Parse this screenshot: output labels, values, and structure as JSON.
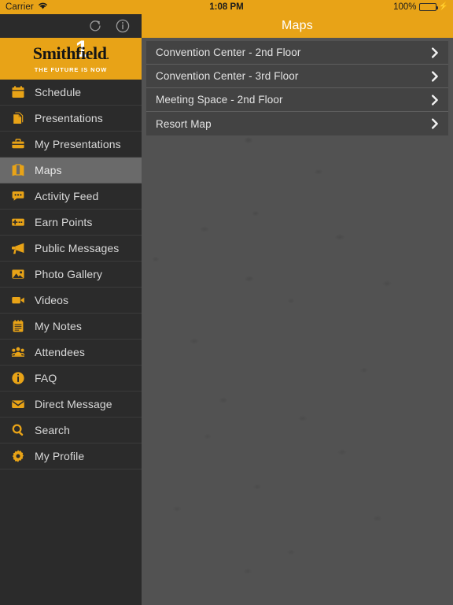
{
  "status_bar": {
    "carrier": "Carrier",
    "wifi_icon": "wifi-icon",
    "time": "1:08 PM",
    "battery_percent": "100%",
    "battery_icon": "battery-full-icon",
    "charging_icon": "lightning-bolt-icon",
    "background_color": "#e8a317"
  },
  "sidebar": {
    "toolbar": {
      "refresh_icon": "refresh-icon",
      "info_icon": "info-circle-icon"
    },
    "logo": {
      "brand": "Smithfield",
      "brand_mark": "1",
      "tagline": "THE FUTURE IS NOW",
      "background_color": "#e8a317"
    },
    "items": [
      {
        "label": "Schedule",
        "icon": "calendar-icon",
        "active": false
      },
      {
        "label": "Presentations",
        "icon": "document-icon",
        "active": false
      },
      {
        "label": "My Presentations",
        "icon": "briefcase-icon",
        "active": false
      },
      {
        "label": "Maps",
        "icon": "map-icon",
        "active": true
      },
      {
        "label": "Activity Feed",
        "icon": "chat-bubble-icon",
        "active": false
      },
      {
        "label": "Earn Points",
        "icon": "ticket-plus-icon",
        "active": false
      },
      {
        "label": "Public Messages",
        "icon": "megaphone-icon",
        "active": false
      },
      {
        "label": "Photo Gallery",
        "icon": "photo-icon",
        "active": false
      },
      {
        "label": "Videos",
        "icon": "video-camera-icon",
        "active": false
      },
      {
        "label": "My Notes",
        "icon": "notepad-icon",
        "active": false
      },
      {
        "label": "Attendees",
        "icon": "people-group-icon",
        "active": false
      },
      {
        "label": "FAQ",
        "icon": "info-circle-icon",
        "active": false
      },
      {
        "label": "Direct Message",
        "icon": "envelope-icon",
        "active": false
      },
      {
        "label": "Search",
        "icon": "magnifier-icon",
        "active": false
      },
      {
        "label": "My Profile",
        "icon": "gear-icon",
        "active": false
      }
    ]
  },
  "content": {
    "navbar": {
      "title": "Maps",
      "background_color": "#e8a317"
    },
    "maps": [
      {
        "label": "Convention Center - 2nd Floor",
        "disclosure_icon": "chevron-right-icon"
      },
      {
        "label": "Convention Center - 3rd Floor",
        "disclosure_icon": "chevron-right-icon"
      },
      {
        "label": "Meeting Space - 2nd Floor",
        "disclosure_icon": "chevron-right-icon"
      },
      {
        "label": "Resort Map",
        "disclosure_icon": "chevron-right-icon"
      }
    ]
  },
  "theme": {
    "accent": "#e8a317",
    "sidebar_bg": "#2b2b2b",
    "sidebar_active_bg": "#6a6a6a",
    "content_bg": "#525252",
    "row_bg": "#434343"
  }
}
